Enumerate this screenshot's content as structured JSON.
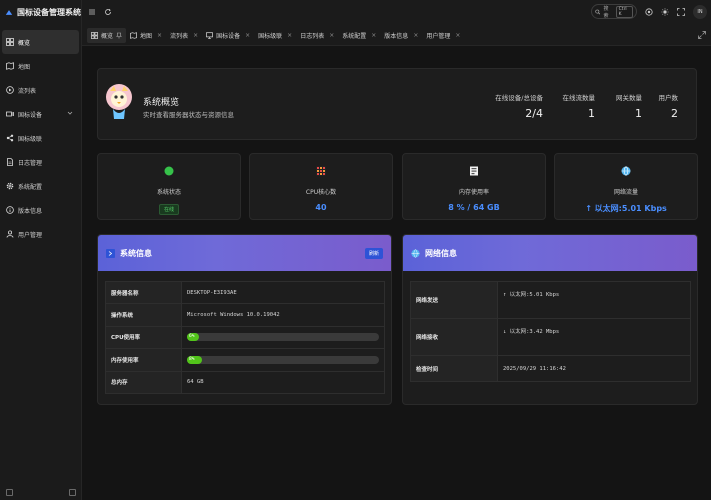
{
  "app": {
    "title": "国标设备管理系统"
  },
  "sidebar": {
    "items": [
      {
        "label": "概览",
        "icon": "grid-icon",
        "active": true
      },
      {
        "label": "地图",
        "icon": "map-icon"
      },
      {
        "label": "流列表",
        "icon": "play-icon"
      },
      {
        "label": "国标设备",
        "icon": "video-camera-icon",
        "has_children": true
      },
      {
        "label": "国标级联",
        "icon": "share-icon"
      },
      {
        "label": "日志管理",
        "icon": "file-icon"
      },
      {
        "label": "系统配置",
        "icon": "gear-icon"
      },
      {
        "label": "版本信息",
        "icon": "info-icon"
      },
      {
        "label": "用户管理",
        "icon": "user-icon"
      }
    ]
  },
  "topbar": {
    "search_label": "搜索",
    "search_shortcut": "Ctrl K",
    "avatar_text": "IN"
  },
  "tabs": [
    {
      "label": "概览",
      "active": true,
      "icon": "grid-icon"
    },
    {
      "label": "地图",
      "icon": "map-icon"
    },
    {
      "label": "流列表"
    },
    {
      "label": "国标设备",
      "icon": "monitor-icon"
    },
    {
      "label": "国标级联"
    },
    {
      "label": "日志列表"
    },
    {
      "label": "系统配置"
    },
    {
      "label": "版本信息"
    },
    {
      "label": "用户管理"
    }
  ],
  "overview": {
    "title": "系统概览",
    "subtitle": "实时查看服务器状态与资源信息",
    "stats": [
      {
        "label": "在线设备/总设备",
        "value": "2/4"
      },
      {
        "label": "在线流数量",
        "value": "1"
      },
      {
        "label": "网关数量",
        "value": "1"
      },
      {
        "label": "用户数",
        "value": "2"
      }
    ]
  },
  "cards": {
    "status": {
      "label": "系统状态",
      "badge": "在线",
      "color": "#36c24a"
    },
    "cpu": {
      "label": "CPU核心数",
      "value": "40"
    },
    "memory": {
      "label": "内存使用率",
      "value": "8 % / 64 GB"
    },
    "network": {
      "label": "网络流量",
      "value": "↑ 以太网:5.01 Kbps"
    }
  },
  "system_info": {
    "title": "系统信息",
    "refresh_label": "刷新",
    "rows": [
      {
        "key": "服务器名称",
        "value": "DESKTOP-E3I93AE"
      },
      {
        "key": "操作系统",
        "value": "Microsoft Windows 10.0.19042"
      },
      {
        "key": "CPU使用率",
        "value": "6%",
        "progress": 0.06
      },
      {
        "key": "内存使用率",
        "value": "8%",
        "progress": 0.08
      },
      {
        "key": "总内存",
        "value": "64 GB"
      }
    ]
  },
  "network_info": {
    "title": "网络信息",
    "rows": [
      {
        "key": "网络发送",
        "value": "↑ 以太网:5.01 Kbps"
      },
      {
        "key": "网络接收",
        "value": "↓ 以太网:3.42 Mbps"
      },
      {
        "key": "检查时间",
        "value": "2025/09/29 11:16:42"
      }
    ]
  }
}
